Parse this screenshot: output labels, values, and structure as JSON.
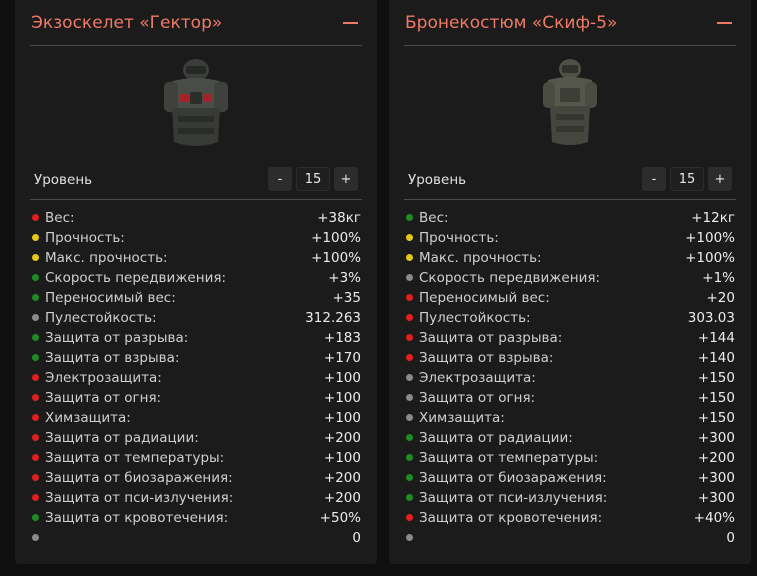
{
  "colors": {
    "green": "#1f8c21",
    "yellow": "#e6c619",
    "red": "#e01f1f",
    "gray": "#8a8a8a",
    "accent": "#f07a66"
  },
  "cards": [
    {
      "title": "Экзоскелет «Гектор»",
      "collapse_icon": "minus-icon",
      "level_label": "Уровень",
      "level": "15",
      "dec_label": "-",
      "inc_label": "+",
      "stats": [
        {
          "label": "Вес:",
          "value": "+38кг",
          "status": "red"
        },
        {
          "label": "Прочность:",
          "value": "+100%",
          "status": "yellow"
        },
        {
          "label": "Макс. прочность:",
          "value": "+100%",
          "status": "yellow"
        },
        {
          "label": "Скорость передвижения:",
          "value": "+3%",
          "status": "green"
        },
        {
          "label": "Переносимый вес:",
          "value": "+35",
          "status": "green"
        },
        {
          "label": "Пулестойкость:",
          "value": "312.263",
          "status": "gray"
        },
        {
          "label": "Защита от разрыва:",
          "value": "+183",
          "status": "green"
        },
        {
          "label": "Защита от взрыва:",
          "value": "+170",
          "status": "green"
        },
        {
          "label": "Электрозащита:",
          "value": "+100",
          "status": "red"
        },
        {
          "label": "Защита от огня:",
          "value": "+100",
          "status": "red"
        },
        {
          "label": "Химзащита:",
          "value": "+100",
          "status": "red"
        },
        {
          "label": "Защита от радиации:",
          "value": "+200",
          "status": "red"
        },
        {
          "label": "Защита от температуры:",
          "value": "+100",
          "status": "red"
        },
        {
          "label": "Защита от биозаражения:",
          "value": "+200",
          "status": "red"
        },
        {
          "label": "Защита от пси-излучения:",
          "value": "+200",
          "status": "red"
        },
        {
          "label": "Защита от кровотечения:",
          "value": "+50%",
          "status": "green"
        },
        {
          "label": "",
          "value": "0",
          "status": "gray"
        }
      ]
    },
    {
      "title": "Бронекостюм «Скиф-5»",
      "collapse_icon": "minus-icon",
      "level_label": "Уровень",
      "level": "15",
      "dec_label": "-",
      "inc_label": "+",
      "stats": [
        {
          "label": "Вес:",
          "value": "+12кг",
          "status": "green"
        },
        {
          "label": "Прочность:",
          "value": "+100%",
          "status": "yellow"
        },
        {
          "label": "Макс. прочность:",
          "value": "+100%",
          "status": "yellow"
        },
        {
          "label": "Скорость передвижения:",
          "value": "+1%",
          "status": "gray"
        },
        {
          "label": "Переносимый вес:",
          "value": "+20",
          "status": "red"
        },
        {
          "label": "Пулестойкость:",
          "value": "303.03",
          "status": "red"
        },
        {
          "label": "Защита от разрыва:",
          "value": "+144",
          "status": "red"
        },
        {
          "label": "Защита от взрыва:",
          "value": "+140",
          "status": "red"
        },
        {
          "label": "Электрозащита:",
          "value": "+150",
          "status": "gray"
        },
        {
          "label": "Защита от огня:",
          "value": "+150",
          "status": "gray"
        },
        {
          "label": "Химзащита:",
          "value": "+150",
          "status": "gray"
        },
        {
          "label": "Защита от радиации:",
          "value": "+300",
          "status": "green"
        },
        {
          "label": "Защита от температуры:",
          "value": "+200",
          "status": "green"
        },
        {
          "label": "Защита от биозаражения:",
          "value": "+300",
          "status": "green"
        },
        {
          "label": "Защита от пси-излучения:",
          "value": "+300",
          "status": "green"
        },
        {
          "label": "Защита от кровотечения:",
          "value": "+40%",
          "status": "red"
        },
        {
          "label": "",
          "value": "0",
          "status": "gray"
        }
      ]
    }
  ]
}
